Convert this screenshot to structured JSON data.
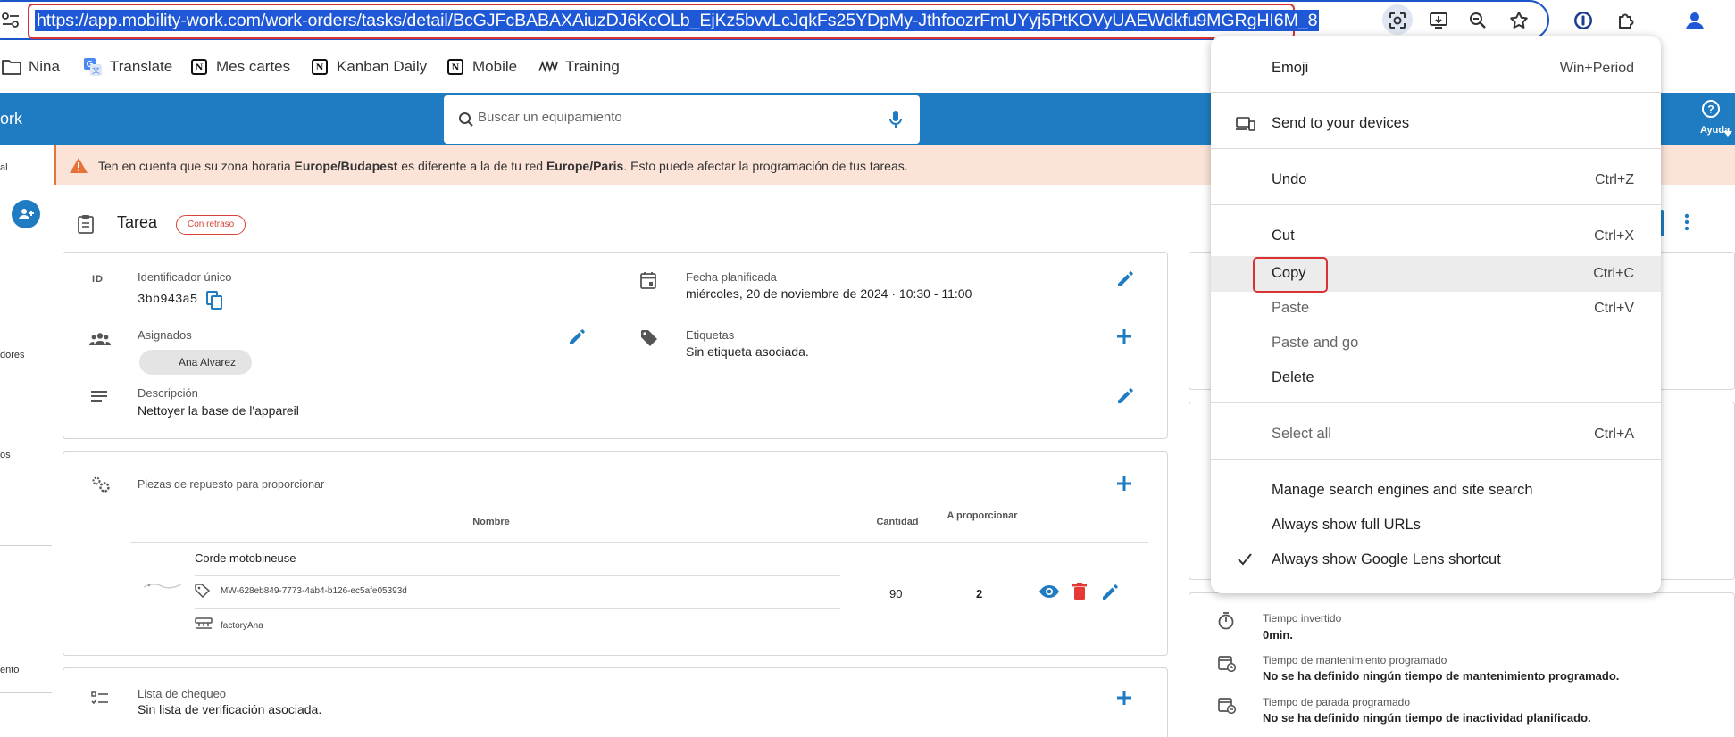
{
  "browser": {
    "url": "https://app.mobility-work.com/work-orders/tasks/detail/BcGJFcBABAXAiuzDJ6KcOLb_EjKz5bvvLcJqkFs25YDpMy-JthfoozrFmUYyj5PtKOVyUAEWdkfu9MGRgHI6M_8",
    "bookmarks": [
      "Nina",
      "Translate",
      "Mes cartes",
      "Kanban Daily",
      "Mobile",
      "Training"
    ]
  },
  "app": {
    "brand_fragment": "ork",
    "search_placeholder": "Buscar un equipamiento",
    "help_label": "Ayuda"
  },
  "sidebar": {
    "fragments": [
      "al",
      "dores",
      "os",
      "ento"
    ]
  },
  "banner": {
    "text_before": "Ten en cuenta que su zona horaria ",
    "zone_user": "Europe/Budapest",
    "text_mid": " es diferente a la de tu red ",
    "zone_network": "Europe/Paris",
    "text_after": ". Esto puede afectar la programación de tus tareas."
  },
  "task": {
    "title": "Tarea",
    "status_badge": "Con retraso",
    "id_icon_text": "ID",
    "id_label": "Identificador único",
    "id_value": "3bb943a5",
    "planned_label": "Fecha planificada",
    "planned_value": "miércoles, 20 de noviembre de 2024 · 10:30 - 11:00",
    "assignees_label": "Asignados",
    "assignee": "Ana Alvarez",
    "tags_label": "Etiquetas",
    "tags_value": "Sin etiqueta asociada.",
    "description_label": "Descripción",
    "description_value": "Nettoyer la base de l'appareil"
  },
  "parts": {
    "title": "Piezas de repuesto para proporcionar",
    "headers": {
      "name": "Nombre",
      "quantity": "Cantidad",
      "provide": "A proporcionar"
    },
    "row": {
      "name": "Corde motobineuse",
      "reference": "MW-628eb849-7773-4ab4-b126-ec5afe05393d",
      "location": "factoryAna",
      "quantity": "90",
      "provide": "2"
    }
  },
  "checklist": {
    "title": "Lista de chequeo",
    "value": "Sin lista de verificación asociada."
  },
  "times": {
    "invested_label": "Tiempo invertido",
    "invested_value": "0min.",
    "maint_label": "Tiempo de mantenimiento programado",
    "maint_value": "No se ha definido ningún tiempo de mantenimiento programado.",
    "stop_label": "Tiempo de parada programado",
    "stop_value": "No se ha definido ningún tiempo de inactividad planificado."
  },
  "context_menu": {
    "items": [
      {
        "label": "Emoji",
        "shortcut": "Win+Period"
      },
      {
        "label": "Send to your devices",
        "shortcut": ""
      },
      {
        "label": "Undo",
        "shortcut": "Ctrl+Z"
      },
      {
        "label": "Cut",
        "shortcut": "Ctrl+X"
      },
      {
        "label": "Copy",
        "shortcut": "Ctrl+C"
      },
      {
        "label": "Paste",
        "shortcut": "Ctrl+V"
      },
      {
        "label": "Paste and go",
        "shortcut": ""
      },
      {
        "label": "Delete",
        "shortcut": ""
      },
      {
        "label": "Select all",
        "shortcut": "Ctrl+A"
      },
      {
        "label": "Manage search engines and site search",
        "shortcut": ""
      },
      {
        "label": "Always show full URLs",
        "shortcut": ""
      },
      {
        "label": "Always show Google Lens shortcut",
        "shortcut": "",
        "checked": true
      }
    ]
  },
  "colors": {
    "brand_blue": "#1f7cc2",
    "highlight_red": "#d93232",
    "banner_bg": "#fbe3d8",
    "warning_orange": "#e57339"
  }
}
